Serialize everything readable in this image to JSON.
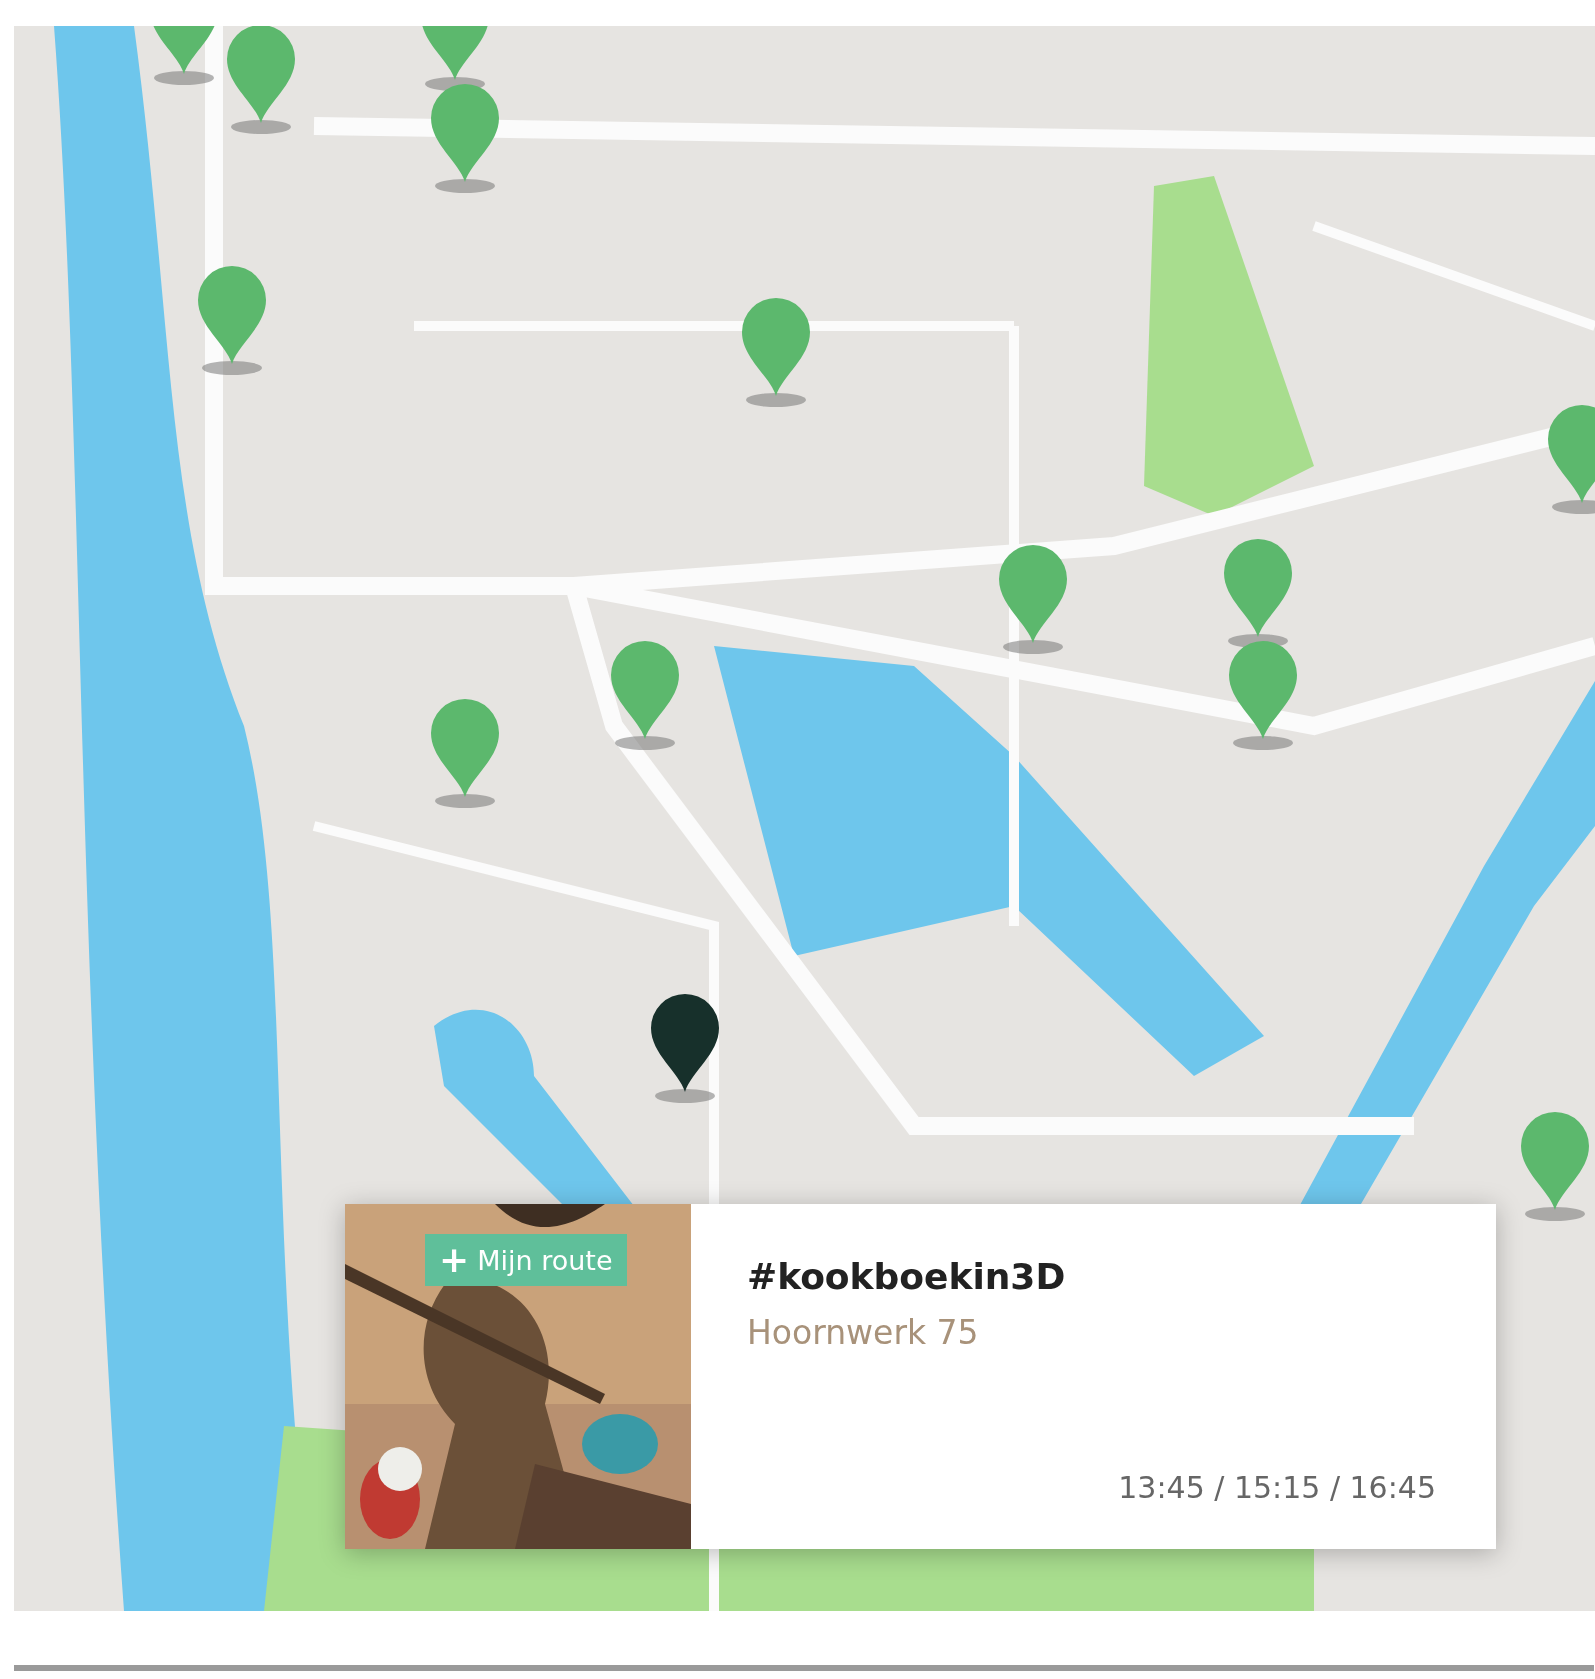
{
  "map": {
    "kind": "picture",
    "pins": [
      {
        "selected": false
      },
      {
        "selected": false
      },
      {
        "selected": false
      },
      {
        "selected": false
      },
      {
        "selected": false
      },
      {
        "selected": false
      },
      {
        "selected": false
      },
      {
        "selected": false
      },
      {
        "selected": false
      },
      {
        "selected": false
      },
      {
        "selected": false
      },
      {
        "selected": false
      },
      {
        "selected": true
      },
      {
        "selected": false
      }
    ]
  },
  "popup": {
    "route_button": {
      "icon": "+",
      "label": "Mijn route"
    },
    "title": "#kookboekin3D",
    "address": "Hoornwerk 75",
    "times": "13:45 / 15:15 / 16:45"
  }
}
